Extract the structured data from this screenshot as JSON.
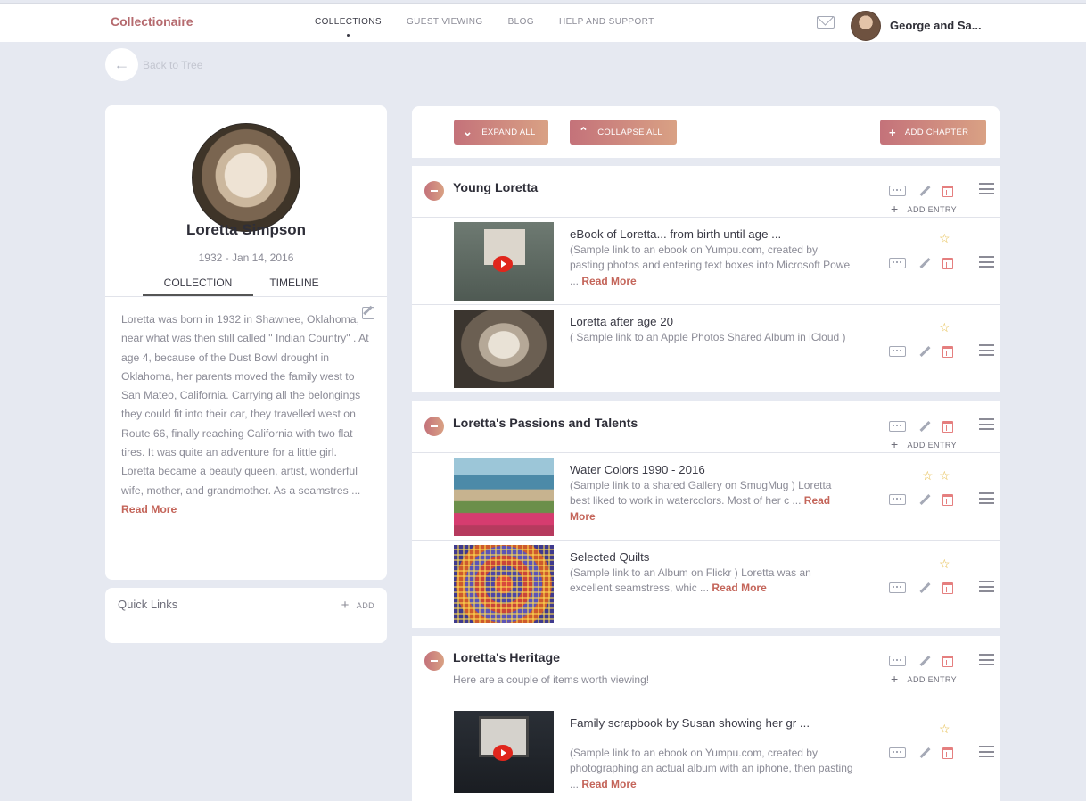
{
  "brand": "Collectionaire",
  "nav": [
    "COLLECTIONS",
    "GUEST VIEWING",
    "BLOG",
    "HELP AND SUPPORT"
  ],
  "user": {
    "name": "George and Sa..."
  },
  "back": {
    "label": "Back to Tree"
  },
  "profile": {
    "name": "Loretta Simpson",
    "dates": "1932 - Jan 14, 2016",
    "tabs": [
      "COLLECTION",
      "TIMELINE"
    ],
    "bio": "Loretta was born in 1932 in Shawnee, Oklahoma, near what was then still called \" Indian Country\" .  At age 4, because of the Dust Bowl drought in Oklahoma, her parents moved the family west to San Mateo, California. Carrying all the belongings they could fit into their car, they travelled west on Route 66, finally reaching California with two flat tires.  It was quite an adventure for a little girl. Loretta became a beauty queen, artist, wonderful wife, mother, and grandmother.  As a seamstres ...",
    "read_more": "Read More"
  },
  "quick_links": {
    "label": "Quick Links",
    "add": "ADD"
  },
  "toolbar": {
    "expand": "EXPAND ALL",
    "collapse": "COLLAPSE ALL",
    "add_chapter": "ADD CHAPTER"
  },
  "add_entry": "ADD ENTRY",
  "read_more": "Read More",
  "chapters": [
    {
      "title": "Young Loretta",
      "entries": [
        {
          "title": "eBook of Loretta... from birth until age ...",
          "desc": "(Sample link to an ebook on Yumpu.com, created by pasting photos and entering text boxes into Microsoft Powe ...",
          "stars": 1
        },
        {
          "title": "Loretta after age 20",
          "desc": "( Sample link to an Apple Photos Shared Album in iCloud )",
          "stars": 1
        }
      ]
    },
    {
      "title": "Loretta's Passions and Talents",
      "entries": [
        {
          "title": "Water Colors 1990 - 2016",
          "desc": "(Sample link to a shared Gallery on SmugMug ) Loretta best liked to work in watercolors. Most of her c ...",
          "stars": 2
        },
        {
          "title": "Selected Quilts",
          "desc": "(Sample link to an Album on Flickr )      Loretta was an excellent seamstress, whic ...",
          "stars": 1
        }
      ]
    },
    {
      "title": "Loretta's Heritage",
      "subtitle": "Here are a couple of items worth viewing!",
      "entries": [
        {
          "title": "Family scrapbook by Susan showing her gr ...",
          "desc": "(Sample link to an ebook on Yumpu.com, created by photographing an actual album with an iphone, then pasting ...",
          "stars": 1
        }
      ]
    }
  ],
  "colors": {
    "brand": "#b56a6e",
    "accent": "#c4655a",
    "star": "#e4b940",
    "trash": "#e57f7f",
    "background": "#e6e9f1"
  }
}
